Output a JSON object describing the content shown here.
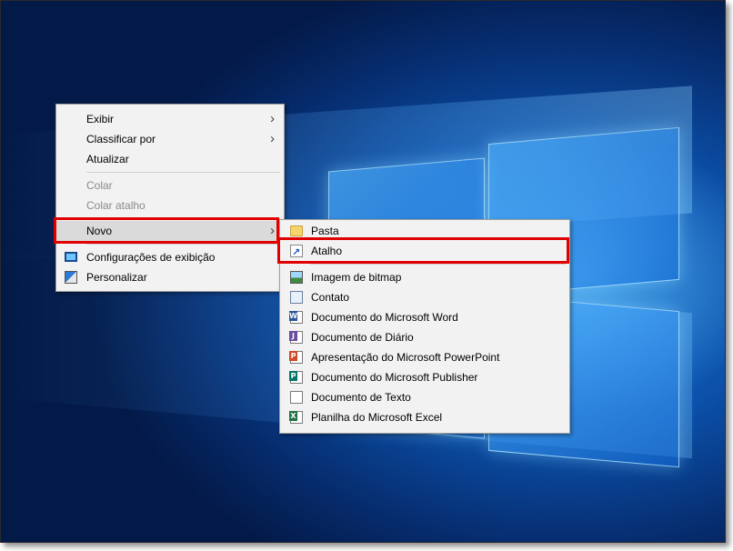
{
  "context_menu": {
    "items": [
      {
        "label": "Exibir",
        "has_submenu": true
      },
      {
        "label": "Classificar por",
        "has_submenu": true
      },
      {
        "label": "Atualizar"
      },
      {
        "label": "Colar",
        "disabled": true
      },
      {
        "label": "Colar atalho",
        "disabled": true
      },
      {
        "label": "Novo",
        "has_submenu": true,
        "highlighted": true
      },
      {
        "label": "Configurações de exibição",
        "icon": "display-settings-icon"
      },
      {
        "label": "Personalizar",
        "icon": "personalize-icon"
      }
    ],
    "submenu_arrow": "›"
  },
  "new_submenu": {
    "items": [
      {
        "label": "Pasta",
        "icon": "folder-icon"
      },
      {
        "label": "Atalho",
        "icon": "shortcut-icon",
        "highlighted_box": true
      },
      {
        "label": "Imagem de bitmap",
        "icon": "bitmap-icon"
      },
      {
        "label": "Contato",
        "icon": "contact-icon"
      },
      {
        "label": "Documento do Microsoft Word",
        "icon": "word-doc-icon",
        "icon_letter": "W"
      },
      {
        "label": "Documento de Diário",
        "icon": "journal-doc-icon",
        "icon_letter": "J"
      },
      {
        "label": "Apresentação do Microsoft PowerPoint",
        "icon": "powerpoint-icon",
        "icon_letter": "P"
      },
      {
        "label": "Documento do Microsoft Publisher",
        "icon": "publisher-icon",
        "icon_letter": "P"
      },
      {
        "label": "Documento de Texto",
        "icon": "text-doc-icon"
      },
      {
        "label": "Planilha do Microsoft Excel",
        "icon": "excel-icon",
        "icon_letter": "X"
      }
    ]
  },
  "colors": {
    "highlight_box": "#e00000",
    "menu_background": "#f2f2f2",
    "hover_background": "#dadada",
    "desktop_blue": "#0b4fa8"
  }
}
